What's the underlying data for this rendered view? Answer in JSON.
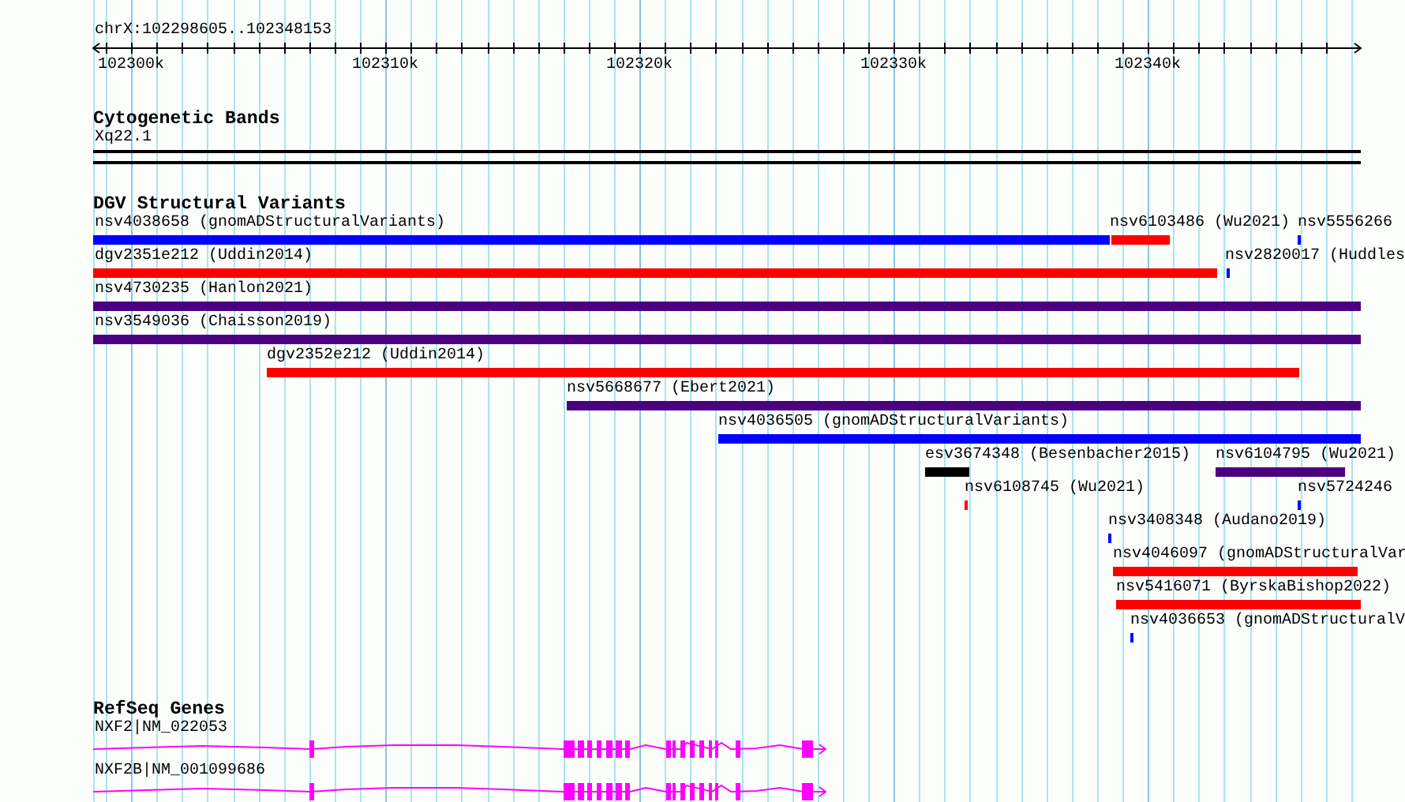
{
  "location": "chrX:102298605..102348153",
  "ruler": {
    "ticks": [
      "102300k",
      "102310k",
      "102320k",
      "102330k",
      "102340k"
    ]
  },
  "tracks": [
    {
      "kind": "bands",
      "title": "Cytogenetic Bands",
      "items": [
        {
          "label": "Xq22.1"
        }
      ]
    },
    {
      "kind": "variants",
      "title": "DGV Structural Variants",
      "rows": [
        {
          "features": [
            {
              "label": "nsv4038658 (gnomADStructuralVariants)",
              "color": "#0000ff"
            },
            {
              "label": "nsv6103486 (Wu2021)",
              "color": "#ff0000"
            },
            {
              "label": "nsv5556266",
              "color": "#0000ff"
            }
          ]
        },
        {
          "features": [
            {
              "label": "dgv2351e212 (Uddin2014)",
              "color": "#ff0000"
            },
            {
              "label": "nsv2820017 (Huddles",
              "color": "#0000ff"
            }
          ]
        },
        {
          "features": [
            {
              "label": "nsv4730235 (Hanlon2021)",
              "color": "#4b0082"
            }
          ]
        },
        {
          "features": [
            {
              "label": "nsv3549036 (Chaisson2019)",
              "color": "#4b0082"
            }
          ]
        },
        {
          "features": [
            {
              "label": "dgv2352e212 (Uddin2014)",
              "color": "#ff0000"
            }
          ]
        },
        {
          "features": [
            {
              "label": "nsv5668677 (Ebert2021)",
              "color": "#4b0082"
            }
          ]
        },
        {
          "features": [
            {
              "label": "nsv4036505 (gnomADStructuralVariants)",
              "color": "#0000ff"
            }
          ]
        },
        {
          "features": [
            {
              "label": "esv3674348 (Besenbacher2015)",
              "color": "#000000"
            },
            {
              "label": "nsv6104795 (Wu2021)",
              "color": "#4b0082"
            }
          ]
        },
        {
          "features": [
            {
              "label": "nsv6108745 (Wu2021)",
              "color": "#ff0000"
            },
            {
              "label": "nsv5724246",
              "color": "#0000ff"
            }
          ]
        },
        {
          "features": [
            {
              "label": "nsv3408348 (Audano2019)",
              "color": "#0000ff"
            }
          ]
        },
        {
          "features": [
            {
              "label": "nsv4046097 (gnomADStructuralVar",
              "color": "#ff0000"
            }
          ]
        },
        {
          "features": [
            {
              "label": "nsv5416071 (ByrskaBishop2022)",
              "color": "#ff0000"
            }
          ]
        },
        {
          "features": [
            {
              "label": "nsv4036653 (gnomADStructuralV",
              "color": "#0000ff"
            }
          ]
        }
      ]
    },
    {
      "kind": "genes",
      "title": "RefSeq Genes",
      "genes": [
        {
          "label": "NXF2|NM_022053"
        },
        {
          "label": "NXF2B|NM_001099686"
        }
      ]
    }
  ]
}
